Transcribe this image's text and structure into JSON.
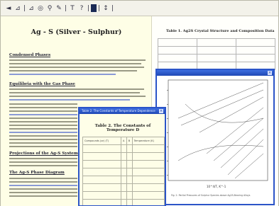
{
  "toolbar": {
    "buttons": [
      "back-icon",
      "forward-icon",
      "print-icon",
      "zoom-icon",
      "search-icon",
      "settings-icon",
      "bookmark-icon",
      "help-icon",
      "tool-icon",
      "refresh-icon"
    ]
  },
  "left_document": {
    "title": "Ag - S (Silver - Sulphur)",
    "sections": [
      "Condensed Phases",
      "Equilibria with the Gas Phase",
      "Projections of the Ag-S System",
      "The Ag-S Phase Diagram"
    ]
  },
  "right_document": {
    "title": "Table 1. Ag2S Crystal Structure and Composition Data"
  },
  "chart_window": {
    "title": "",
    "x_axis_label": "10^4/T, K^-1",
    "caption": "Fig. 2. Partial Pressures of Sulphur Species above Ag2S-Bearing Alloys"
  },
  "popup_window": {
    "title_bar": "Table 2. The Constants of Temperature Dependence",
    "title": "Table 2. The Constants of Temperature D",
    "headers": [
      "Compounds (or) (T)",
      "A",
      "B",
      "Temperature (K)"
    ]
  }
}
